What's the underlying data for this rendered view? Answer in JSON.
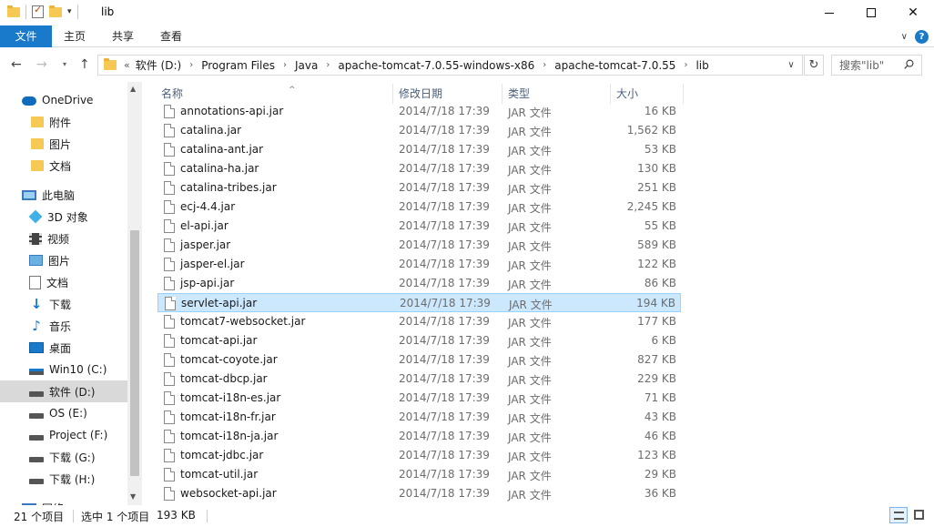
{
  "window": {
    "title": "lib",
    "minimize_icon": "minimize-icon",
    "maximize_icon": "maximize-icon",
    "close_label": "✕"
  },
  "ribbon": {
    "file_tab": "文件",
    "tabs": [
      "主页",
      "共享",
      "查看"
    ]
  },
  "address": {
    "overflow": "«",
    "crumbs": [
      "软件 (D:)",
      "Program Files",
      "Java",
      "apache-tomcat-7.0.55-windows-x86",
      "apache-tomcat-7.0.55",
      "lib"
    ],
    "search_placeholder": "搜索\"lib\""
  },
  "nav_pane": {
    "items": [
      {
        "label": "OneDrive",
        "icon": "onedrive-icon"
      },
      {
        "label": "附件",
        "icon": "folder-icon"
      },
      {
        "label": "图片",
        "icon": "folder-icon"
      },
      {
        "label": "文档",
        "icon": "folder-icon"
      },
      {
        "label": "此电脑",
        "icon": "computer-icon"
      },
      {
        "label": "3D 对象",
        "icon": "3d-objects-icon"
      },
      {
        "label": "视频",
        "icon": "video-icon"
      },
      {
        "label": "图片",
        "icon": "pictures-icon"
      },
      {
        "label": "文档",
        "icon": "documents-icon"
      },
      {
        "label": "下载",
        "icon": "downloads-icon"
      },
      {
        "label": "音乐",
        "icon": "music-icon"
      },
      {
        "label": "桌面",
        "icon": "desktop-icon"
      },
      {
        "label": "Win10 (C:)",
        "icon": "windows-drive-icon"
      },
      {
        "label": "软件 (D:)",
        "icon": "drive-icon"
      },
      {
        "label": "OS (E:)",
        "icon": "drive-icon"
      },
      {
        "label": "Project (F:)",
        "icon": "drive-icon"
      },
      {
        "label": "下载 (G:)",
        "icon": "drive-icon"
      },
      {
        "label": "下载 (H:)",
        "icon": "drive-icon"
      },
      {
        "label": "网络",
        "icon": "network-icon"
      }
    ]
  },
  "columns": {
    "name": "名称",
    "date": "修改日期",
    "type": "类型",
    "size": "大小"
  },
  "files": [
    {
      "name": "annotations-api.jar",
      "date": "2014/7/18 17:39",
      "type": "JAR 文件",
      "size": "16 KB"
    },
    {
      "name": "catalina.jar",
      "date": "2014/7/18 17:39",
      "type": "JAR 文件",
      "size": "1,562 KB"
    },
    {
      "name": "catalina-ant.jar",
      "date": "2014/7/18 17:39",
      "type": "JAR 文件",
      "size": "53 KB"
    },
    {
      "name": "catalina-ha.jar",
      "date": "2014/7/18 17:39",
      "type": "JAR 文件",
      "size": "130 KB"
    },
    {
      "name": "catalina-tribes.jar",
      "date": "2014/7/18 17:39",
      "type": "JAR 文件",
      "size": "251 KB"
    },
    {
      "name": "ecj-4.4.jar",
      "date": "2014/7/18 17:39",
      "type": "JAR 文件",
      "size": "2,245 KB"
    },
    {
      "name": "el-api.jar",
      "date": "2014/7/18 17:39",
      "type": "JAR 文件",
      "size": "55 KB"
    },
    {
      "name": "jasper.jar",
      "date": "2014/7/18 17:39",
      "type": "JAR 文件",
      "size": "589 KB"
    },
    {
      "name": "jasper-el.jar",
      "date": "2014/7/18 17:39",
      "type": "JAR 文件",
      "size": "122 KB"
    },
    {
      "name": "jsp-api.jar",
      "date": "2014/7/18 17:39",
      "type": "JAR 文件",
      "size": "86 KB"
    },
    {
      "name": "servlet-api.jar",
      "date": "2014/7/18 17:39",
      "type": "JAR 文件",
      "size": "194 KB",
      "selected": true
    },
    {
      "name": "tomcat7-websocket.jar",
      "date": "2014/7/18 17:39",
      "type": "JAR 文件",
      "size": "177 KB"
    },
    {
      "name": "tomcat-api.jar",
      "date": "2014/7/18 17:39",
      "type": "JAR 文件",
      "size": "6 KB"
    },
    {
      "name": "tomcat-coyote.jar",
      "date": "2014/7/18 17:39",
      "type": "JAR 文件",
      "size": "827 KB"
    },
    {
      "name": "tomcat-dbcp.jar",
      "date": "2014/7/18 17:39",
      "type": "JAR 文件",
      "size": "229 KB"
    },
    {
      "name": "tomcat-i18n-es.jar",
      "date": "2014/7/18 17:39",
      "type": "JAR 文件",
      "size": "71 KB"
    },
    {
      "name": "tomcat-i18n-fr.jar",
      "date": "2014/7/18 17:39",
      "type": "JAR 文件",
      "size": "43 KB"
    },
    {
      "name": "tomcat-i18n-ja.jar",
      "date": "2014/7/18 17:39",
      "type": "JAR 文件",
      "size": "46 KB"
    },
    {
      "name": "tomcat-jdbc.jar",
      "date": "2014/7/18 17:39",
      "type": "JAR 文件",
      "size": "123 KB"
    },
    {
      "name": "tomcat-util.jar",
      "date": "2014/7/18 17:39",
      "type": "JAR 文件",
      "size": "29 KB"
    },
    {
      "name": "websocket-api.jar",
      "date": "2014/7/18 17:39",
      "type": "JAR 文件",
      "size": "36 KB"
    }
  ],
  "status": {
    "item_count": "21 个项目",
    "selection": "选中 1 个项目",
    "selection_size": "193 KB"
  },
  "colors": {
    "accent": "#1979ca",
    "selection_bg": "#cce8ff",
    "selection_border": "#99d1ff"
  }
}
